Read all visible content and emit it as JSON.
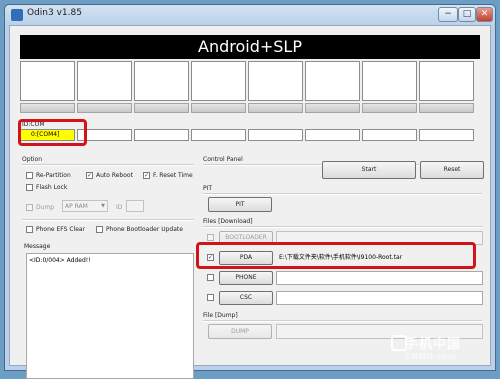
{
  "window": {
    "title": "Odin3 v1.85",
    "controls": {
      "minimize": "−",
      "maximize": "□",
      "close": "✕"
    }
  },
  "banner": "Android+SLP",
  "id_com": {
    "label": "ID:COM",
    "ports": [
      "0:[COM4]",
      "",
      "",
      "",
      "",
      "",
      "",
      ""
    ],
    "active_color": "#ffff00"
  },
  "options": {
    "group_title": "Option",
    "re_partition": {
      "label": "Re-Partition",
      "checked": false
    },
    "auto_reboot": {
      "label": "Auto Reboot",
      "checked": true
    },
    "f_reset_time": {
      "label": "F. Reset Time",
      "checked": true
    },
    "flash_lock": {
      "label": "Flash Lock",
      "checked": false
    },
    "dump": {
      "label": "Dump",
      "checked": false,
      "enabled": false
    },
    "dump_target": "AP RAM",
    "id_label": "ID",
    "id_value": "",
    "phone_efs_clear": {
      "label": "Phone EFS Clear",
      "checked": false
    },
    "phone_bootloader_update": {
      "label": "Phone Bootloader Update",
      "checked": false
    }
  },
  "message": {
    "group_title": "Message",
    "log": "<ID:0/004> Added!!"
  },
  "control_panel": {
    "title": "Control Panel",
    "start": "Start",
    "reset": "Reset"
  },
  "pit": {
    "title": "PIT",
    "button": "PIT"
  },
  "files": {
    "title": "Files [Download]",
    "bootloader": {
      "button": "BOOTLOADER",
      "checked": false,
      "enabled": false,
      "path": ""
    },
    "pda": {
      "button": "PDA",
      "checked": true,
      "enabled": true,
      "path": "E:\\下载文件夹\\软件\\手机软件\\I9100-Root.tar"
    },
    "phone": {
      "button": "PHONE",
      "checked": false,
      "enabled": true,
      "path": ""
    },
    "csc": {
      "button": "CSC",
      "checked": false,
      "enabled": true,
      "path": ""
    }
  },
  "file_dump": {
    "title": "File [Dump]",
    "button": "DUMP",
    "path": ""
  },
  "watermark": {
    "line1": "手机中国",
    "line2": "CNMO.com"
  },
  "colors": {
    "highlight": "#d1141a",
    "window_frame": "#b9d1ea",
    "desktop": "#6c9ec5"
  }
}
